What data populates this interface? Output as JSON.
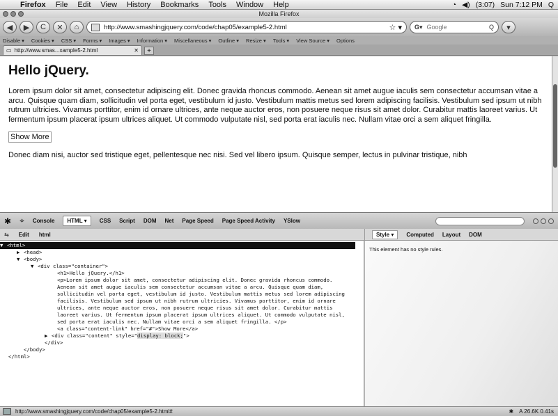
{
  "menubar": {
    "apple": "",
    "items": [
      "Firefox",
      "File",
      "Edit",
      "View",
      "History",
      "Bookmarks",
      "Tools",
      "Window",
      "Help"
    ],
    "battery": "(3:07)",
    "clock": "Sun 7:12 PM",
    "search_icon": "Q"
  },
  "window": {
    "title": "Mozilla Firefox"
  },
  "nav": {
    "back": "◀",
    "forward": "▶",
    "reload": "C",
    "stop": "✕",
    "home": "⌂",
    "url": "http://www.smashingjquery.com/code/chap05/example5-2.html",
    "star": "☆ ▾",
    "search_engine": "G▾",
    "search_placeholder": "Google",
    "search_glass": "Q"
  },
  "webdev_toolbar": [
    "Disable ▾",
    "Cookies ▾",
    "CSS ▾",
    "Forms ▾",
    "Images ▾",
    "Information ▾",
    "Miscellaneous ▾",
    "Outline ▾",
    "Resize ▾",
    "Tools ▾",
    "View Source ▾",
    "Options"
  ],
  "tabs": [
    {
      "label": "http://www.smas...xample5-2.html",
      "close": "✕"
    }
  ],
  "newtab": "+",
  "page": {
    "heading": "Hello jQuery.",
    "para1": "Lorem ipsum dolor sit amet, consectetur adipiscing elit. Donec gravida rhoncus commodo. Aenean sit amet augue iaculis sem consectetur accumsan vitae a arcu. Quisque quam diam, sollicitudin vel porta eget, vestibulum id justo. Vestibulum mattis metus sed lorem adipiscing facilisis. Vestibulum sed ipsum ut nibh rutrum ultricies. Vivamus porttitor, enim id ornare ultrices, ante neque auctor eros, non posuere neque risus sit amet dolor. Curabitur mattis laoreet varius. Ut fermentum ipsum placerat ipsum ultrices aliquet. Ut commodo vulputate nisl, sed porta erat iaculis nec. Nullam vitae orci a sem aliquet fringilla.",
    "show_more": "Show More",
    "para2": "Donec diam nisi, auctor sed tristique eget, pellentesque nec nisi. Sed vel libero ipsum. Quisque semper, lectus in pulvinar tristique, nibh"
  },
  "firebug": {
    "tabs": [
      "Console",
      "HTML ▾",
      "CSS",
      "Script",
      "DOM",
      "Net",
      "Page Speed",
      "Page Speed Activity",
      "YSlow"
    ],
    "sub_left": [
      "Edit",
      "html"
    ],
    "sub_right": [
      "Style ▾",
      "Computed",
      "Layout",
      "DOM"
    ],
    "style_message": "This element has no style rules.",
    "html_lines": {
      "l1": "<html>",
      "l2": "<head>",
      "l3": "<body>",
      "l4": "<div class=\"container\">",
      "l5": "<h1>Hello jQuery.</h1>",
      "l6": "<p>Lorem ipsum dolor sit amet, consectetur adipiscing elit. Donec gravida rhoncus commodo. Aenean sit amet augue iaculis sem consectetur accumsan vitae a arcu. Quisque quam diam, sollicitudin vel porta eget, vestibulum id justo. Vestibulum mattis metus sed lorem adipiscing facilisis. Vestibulum sed ipsum ut nibh rutrum ultricies. Vivamus porttitor, enim id ornare ultrices, ante neque auctor eros, non posuere neque risus sit amet dolor. Curabitur mattis laoreet varius. Ut fermentum ipsum placerat ipsum ultrices aliquet. Ut commodo vulputate nisl, sed porta erat iaculis nec. Nullam vitae orci a sem aliquet fringilla. </p>",
      "l7": "<a class=\"content-link\" href=\"#\">Show More</a>",
      "l8a": "<div class=\"content\" style=\"",
      "l8b": "display: block;",
      "l8c": "\">",
      "l9": "</div>",
      "l10": "</body>",
      "l11": "</html>"
    }
  },
  "status": {
    "url": "http://www.smashingjquery.com/code/chap05/example5-2.html#",
    "size": "A  26.6K  0.41s"
  }
}
